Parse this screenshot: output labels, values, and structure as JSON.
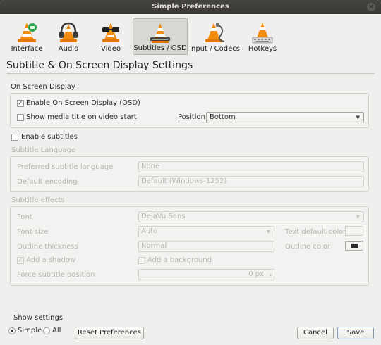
{
  "window": {
    "title": "Simple Preferences",
    "close_glyph": "×"
  },
  "toolbar": {
    "items": [
      {
        "label": "Interface",
        "icon": "vlc-cone-icon"
      },
      {
        "label": "Audio",
        "icon": "headphones-cone-icon"
      },
      {
        "label": "Video",
        "icon": "glasses-cone-icon"
      },
      {
        "label": "Subtitles / OSD",
        "icon": "subtitles-cone-icon",
        "active": true
      },
      {
        "label": "Input / Codecs",
        "icon": "cable-cone-icon"
      },
      {
        "label": "Hotkeys",
        "icon": "keyboard-cone-icon"
      }
    ]
  },
  "page": {
    "title": "Subtitle & On Screen Display Settings"
  },
  "osd": {
    "section": "On Screen Display",
    "enable_osd": {
      "label": "Enable On Screen Display (OSD)",
      "checked": "✓"
    },
    "show_title": {
      "label": "Show media title on video start",
      "checked": ""
    },
    "position_label": "Position",
    "position_value": "Bottom"
  },
  "subtitles": {
    "enable_label": "Enable subtitles",
    "language_section": "Subtitle Language",
    "preferred_label": "Preferred subtitle language",
    "preferred_value": "None",
    "encoding_label": "Default encoding",
    "encoding_value": "Default (Windows-1252)",
    "effects_section": "Subtitle effects",
    "font_label": "Font",
    "font_value": "DejaVu Sans",
    "font_size_label": "Font size",
    "font_size_value": "Auto",
    "text_color_label": "Text default color",
    "outline_thickness_label": "Outline thickness",
    "outline_thickness_value": "Normal",
    "outline_color_label": "Outline color",
    "shadow_label": "Add a shadow",
    "shadow_checked": "✓",
    "background_label": "Add a background",
    "force_position_label": "Force subtitle position",
    "force_position_value": "0 px"
  },
  "footer": {
    "show_settings": "Show settings",
    "simple": "Simple",
    "all": "All",
    "reset": "Reset Preferences",
    "cancel": "Cancel",
    "save": "Save"
  },
  "colors": {
    "accent_border": "#7b98bf",
    "titlebar": "#3c3b37",
    "vlc_orange": "#f28c0f"
  }
}
